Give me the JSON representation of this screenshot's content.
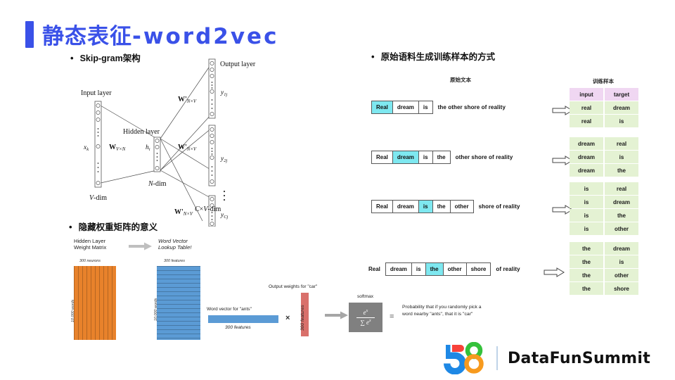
{
  "slide": {
    "title_cn": "静态表征",
    "title_latin": "-word2vec",
    "accent_color": "#3A51E8"
  },
  "left": {
    "bullet_skipgram": "Skip-gram架构",
    "bullet_hidden_matrix": "隐藏权重矩阵的意义",
    "network": {
      "input_layer": "Input layer",
      "hidden_layer": "Hidden layer",
      "output_layer": "Output layer",
      "x_k": "x",
      "x_k_sub": "k",
      "h_i": "h",
      "h_i_sub": "i",
      "w_vn": "W",
      "w_vn_sub": "V×N",
      "w_nv": "W'",
      "w_nv_sub": "N×V",
      "y_1j": "y",
      "y_1j_sub": "1j",
      "y_2j": "y",
      "y_2j_sub": "2j",
      "y_cj": "y",
      "y_cj_sub": "Cj",
      "v_dim": "V-dim",
      "n_dim": "N-dim",
      "cv_dim": "C×V-dim"
    },
    "hidden_matrix": {
      "left_caption_line1": "Hidden Layer",
      "left_caption_line2": "Weight Matrix",
      "right_caption_line1": "Word Vector",
      "right_caption_line2": "Lookup Table!",
      "orange_top_label": "300   neurons",
      "orange_side_label": "10,000  words",
      "blue_top_label": "300   features",
      "blue_side_label": "10,000  words",
      "orange_color": "#E8822B",
      "blue_color": "#5B9BD5"
    },
    "softmax_row": {
      "word_vector_caption": "Word vector for \"ants\"",
      "word_vector_sub": "300 features",
      "output_weights_caption": "Output weights for \"car\"",
      "output_weights_vert": "300 features",
      "multiply_symbol": "×",
      "softmax_label": "softmax",
      "numerator": "e",
      "numerator_sup": "x",
      "denominator_sum": "∑",
      "denominator_e": "e",
      "denominator_sup": "x",
      "equals_symbol": "=",
      "probability_text": "Probability that if you randomly pick a word nearby \"ants\", that it is \"car\""
    }
  },
  "right": {
    "bullet_corpus": "原始语料生成训练样本的方式",
    "caption_raw_text": "原始文本",
    "caption_samples": "训练样本",
    "sentences": [
      {
        "prefix": "",
        "cells": [
          {
            "word": "Real",
            "highlight": true
          },
          {
            "word": "dream",
            "highlight": false
          },
          {
            "word": "is",
            "highlight": false
          }
        ],
        "tail": "the other shore of reality"
      },
      {
        "prefix": "",
        "cells": [
          {
            "word": "Real",
            "highlight": false
          },
          {
            "word": "dream",
            "highlight": true
          },
          {
            "word": "is",
            "highlight": false
          },
          {
            "word": "the",
            "highlight": false
          }
        ],
        "tail": "other shore of reality"
      },
      {
        "prefix": "",
        "cells": [
          {
            "word": "Real",
            "highlight": false
          },
          {
            "word": "dream",
            "highlight": false
          },
          {
            "word": "is",
            "highlight": true
          },
          {
            "word": "the",
            "highlight": false
          },
          {
            "word": "other",
            "highlight": false
          }
        ],
        "tail": "shore of reality"
      },
      {
        "prefix": "Real",
        "cells": [
          {
            "word": "dream",
            "highlight": false
          },
          {
            "word": "is",
            "highlight": false
          },
          {
            "word": "the",
            "highlight": true
          },
          {
            "word": "other",
            "highlight": false
          },
          {
            "word": "shore",
            "highlight": false
          }
        ],
        "tail": "of reality"
      }
    ],
    "sample_groups": [
      {
        "header": [
          "input",
          "target"
        ],
        "rows": [
          [
            "real",
            "dream"
          ],
          [
            "real",
            "is"
          ]
        ]
      },
      {
        "header": null,
        "rows": [
          [
            "dream",
            "real"
          ],
          [
            "dream",
            "is"
          ],
          [
            "dream",
            "the"
          ]
        ]
      },
      {
        "header": null,
        "rows": [
          [
            "is",
            "real"
          ],
          [
            "is",
            "dream"
          ],
          [
            "is",
            "the"
          ],
          [
            "is",
            "other"
          ]
        ]
      },
      {
        "header": null,
        "rows": [
          [
            "the",
            "dream"
          ],
          [
            "the",
            "is"
          ],
          [
            "the",
            "other"
          ],
          [
            "the",
            "shore"
          ]
        ]
      }
    ],
    "colors": {
      "header_bg": "#F0D7F2",
      "row_bg": "#E4F2D3",
      "highlight": "#7EE8F0"
    }
  },
  "footer": {
    "logo_text": "58",
    "brand": "DataFunSummit",
    "logo_colors": {
      "five_red": "#F8423A",
      "five_blue": "#1E88E5",
      "eight_green": "#35C13B",
      "eight_orange": "#F79A1E"
    }
  }
}
